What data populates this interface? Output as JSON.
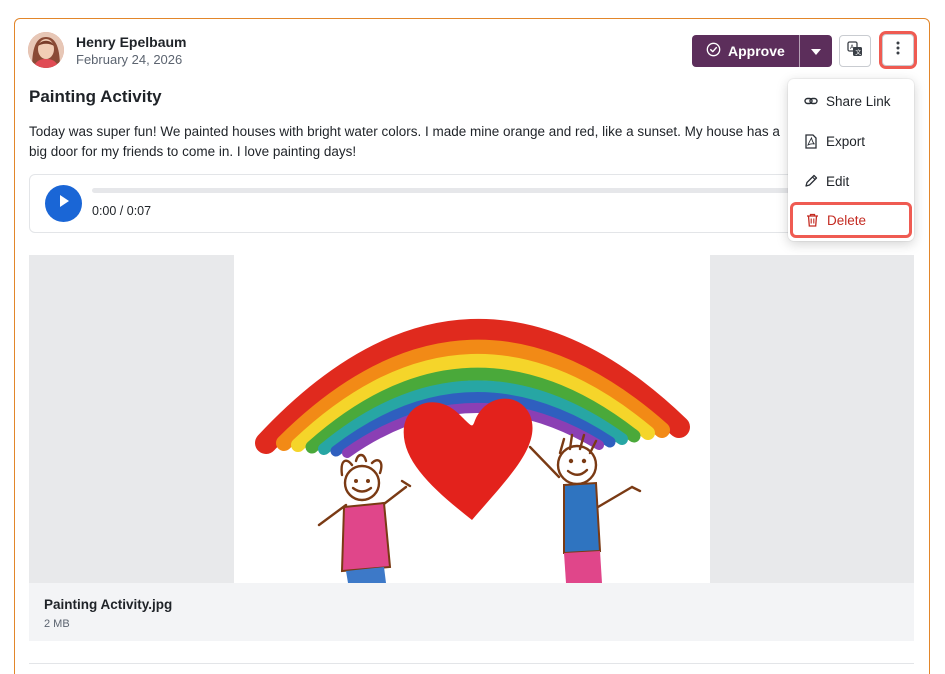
{
  "post": {
    "author": "Henry Epelbaum",
    "date": "February 24, 2026",
    "title": "Painting Activity",
    "body": "Today was super fun! We painted houses with bright water colors. I made mine orange and red, like a sunset. My house has a big door for my friends to come in. I love painting days!"
  },
  "toolbar": {
    "approve_label": "Approve",
    "approve_color": "#5c2e5b"
  },
  "audio": {
    "time": "0:00 / 0:07",
    "progress": 0
  },
  "attachment": {
    "name": "Painting Activity.jpg",
    "size": "2 MB"
  },
  "menu": {
    "items": [
      {
        "label": "Share Link",
        "icon": "link-icon"
      },
      {
        "label": "Export",
        "icon": "pdf-file-icon"
      },
      {
        "label": "Edit",
        "icon": "pencil-icon"
      },
      {
        "label": "Delete",
        "icon": "trash-icon",
        "color": "#c42b22"
      }
    ]
  },
  "colors": {
    "card_border": "#e2862a",
    "highlight": "#ef5b52",
    "play_button": "#1a66d6"
  }
}
